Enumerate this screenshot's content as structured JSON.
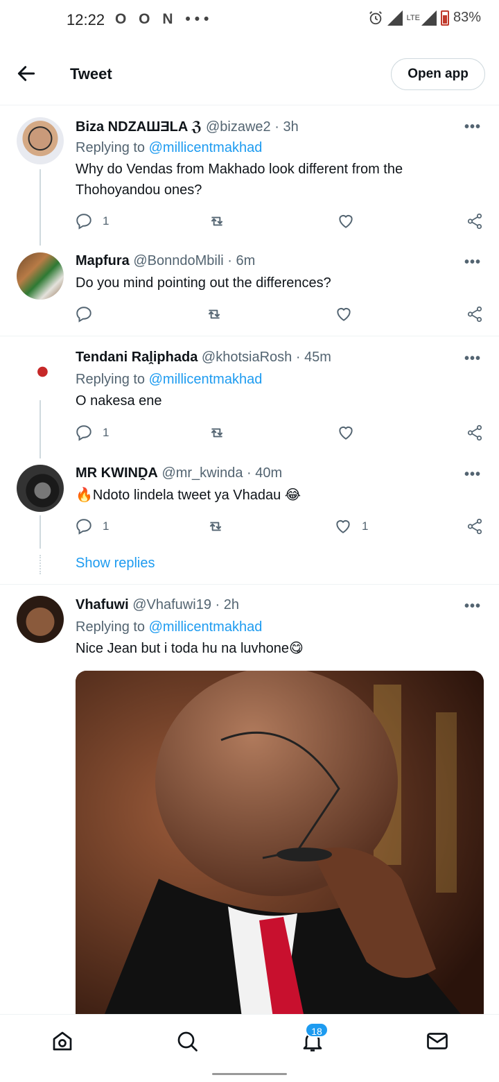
{
  "status_bar": {
    "time": "12:22",
    "notif_icons": "O O N •••",
    "lte": "LTE",
    "battery": "83%"
  },
  "header": {
    "title": "Tweet",
    "open_app": "Open app"
  },
  "tweets": [
    {
      "name": "Biza NDZAШƎLA ℨ",
      "handle": "@bizawe2",
      "dot": "·",
      "time": "3h",
      "replying_prefix": "Replying to",
      "replying_to": "@millicentmakhad",
      "text": "Why do Vendas from Makhado look different from the Thohoyandou ones?",
      "reply_count": "1",
      "like_count": ""
    },
    {
      "name": "Mapfura",
      "handle": "@BonndoMbili",
      "dot": "·",
      "time": "6m",
      "text": "Do you mind pointing out the differences?",
      "reply_count": "",
      "like_count": ""
    },
    {
      "name": "Tendani Raḽiphada",
      "handle": "@khotsiaRosh",
      "dot": "·",
      "time": "45m",
      "replying_prefix": "Replying to",
      "replying_to": "@millicentmakhad",
      "text": "O nakesa ene",
      "reply_count": "1",
      "like_count": ""
    },
    {
      "name": "MR KWINḒA",
      "handle": "@mr_kwinda",
      "dot": "·",
      "time": "40m",
      "text": "🔥Ndoto lindela tweet ya Vhadau 😂",
      "reply_count": "1",
      "like_count": "1"
    },
    {
      "name": "Vhafuwi",
      "handle": "@Vhafuwi19",
      "dot": "·",
      "time": "2h",
      "replying_prefix": "Replying to",
      "replying_to": "@millicentmakhad",
      "text": "Nice Jean but i toda hu na luvhone😋"
    }
  ],
  "show_replies": "Show replies",
  "more_label": "•••",
  "bottom_nav": {
    "items": [
      "home-icon",
      "search-icon",
      "notifications-icon",
      "messages-icon"
    ],
    "notification_badge": "18"
  },
  "colors": {
    "accent": "#1d9bf0",
    "text": "#0f1419",
    "secondary": "#536471",
    "divider": "#eff3f4"
  }
}
